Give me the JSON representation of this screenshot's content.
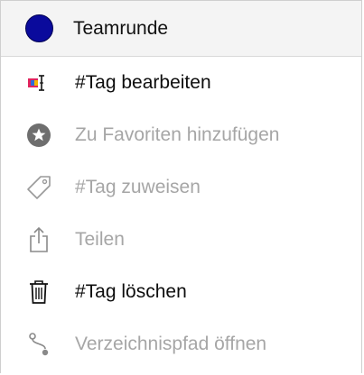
{
  "header": {
    "title": "Teamrunde",
    "dot_color": "#0a0a9c"
  },
  "menu": {
    "items": [
      {
        "label": "#Tag bearbeiten",
        "icon": "tag-edit-icon",
        "enabled": true
      },
      {
        "label": "Zu Favoriten hinzufügen",
        "icon": "star-badge-icon",
        "enabled": false
      },
      {
        "label": "#Tag zuweisen",
        "icon": "tag-icon",
        "enabled": false
      },
      {
        "label": "Teilen",
        "icon": "share-icon",
        "enabled": false
      },
      {
        "label": "#Tag löschen",
        "icon": "trash-icon",
        "enabled": true
      },
      {
        "label": "Verzeichnispfad öffnen",
        "icon": "path-icon",
        "enabled": false
      }
    ]
  },
  "colors": {
    "enabled_text": "#0d0d0d",
    "disabled_text": "#a6a6a6",
    "header_bg": "#f4f4f4"
  }
}
